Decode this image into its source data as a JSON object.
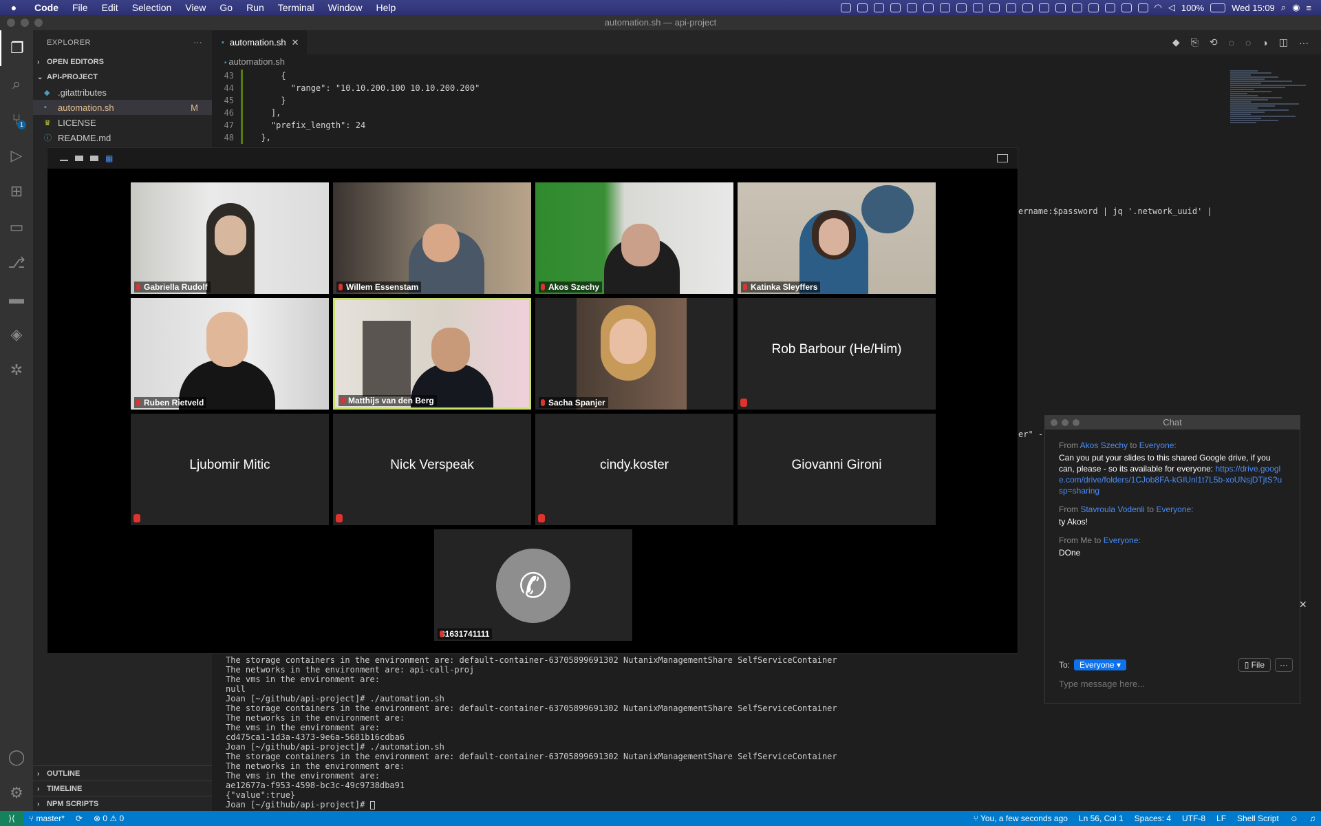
{
  "menubar": {
    "app": "Code",
    "menus": [
      "File",
      "Edit",
      "Selection",
      "View",
      "Go",
      "Run",
      "Terminal",
      "Window",
      "Help"
    ],
    "battery": "100%",
    "clock": "Wed 15:09"
  },
  "window": {
    "title": "automation.sh — api-project"
  },
  "activity_bar": {
    "scm_badge": "1"
  },
  "sidebar": {
    "title": "EXPLORER",
    "open_editors": "OPEN EDITORS",
    "project": "API-PROJECT",
    "files": [
      {
        "name": ".gitattributes",
        "status": ""
      },
      {
        "name": "automation.sh",
        "status": "M"
      },
      {
        "name": "LICENSE",
        "status": ""
      },
      {
        "name": "README.md",
        "status": ""
      }
    ],
    "outline": "OUTLINE",
    "timeline": "TIMELINE",
    "npm": "NPM SCRIPTS"
  },
  "editor": {
    "tab": "automation.sh",
    "breadcrumb": "automation.sh",
    "lines": [
      {
        "n": "43",
        "text": "      {"
      },
      {
        "n": "44",
        "text": "        \"range\": \"10.10.200.100 10.10.200.200\""
      },
      {
        "n": "45",
        "text": "      }"
      },
      {
        "n": "46",
        "text": "    ],"
      },
      {
        "n": "47",
        "text": "    \"prefix_length\": 24"
      },
      {
        "n": "48",
        "text": "  },"
      }
    ],
    "fragment1": "ername:$password | jq '.network_uuid' |",
    "fragment2": "er\" -"
  },
  "terminal": {
    "lines": [
      "The storage containers in the environment are: default-container-63705899691302 NutanixManagementShare SelfServiceContainer",
      "The networks in the environment are: api-call-proj",
      "The vms in the environment are:",
      "null",
      "Joan [~/github/api-project]# ./automation.sh",
      "The storage containers in the environment are: default-container-63705899691302 NutanixManagementShare SelfServiceContainer",
      "The networks in the environment are:",
      "The vms in the environment are:",
      "cd475ca1-1d3a-4373-9e6a-5681b16cdba6",
      "Joan [~/github/api-project]# ./automation.sh",
      "The storage containers in the environment are: default-container-63705899691302 NutanixManagementShare SelfServiceContainer",
      "The networks in the environment are:",
      "The vms in the environment are:",
      "ae12677a-f953-4598-bc3c-49c9738dba91",
      "{\"value\":true}"
    ],
    "prompt": "Joan [~/github/api-project]# "
  },
  "statusbar": {
    "branch": "master*",
    "problems": "⊗ 0 ⚠ 0",
    "blame": "You, a few seconds ago",
    "position": "Ln 56, Col 1",
    "spaces": "Spaces: 4",
    "encoding": "UTF-8",
    "eol": "LF",
    "language": "Shell Script"
  },
  "meeting": {
    "participants": [
      {
        "name": "Gabriella Rudolf",
        "video": true
      },
      {
        "name": "Willem Essenstam",
        "video": true
      },
      {
        "name": "Akos Szechy",
        "video": true
      },
      {
        "name": "Katinka Sleyffers",
        "video": true
      },
      {
        "name": "Ruben Rietveld",
        "video": true
      },
      {
        "name": "Matthijs van den Berg",
        "video": true,
        "speaking": true
      },
      {
        "name": "Sacha Spanjer",
        "video": true
      },
      {
        "name": "Rob Barbour (He/Him)",
        "video": false
      },
      {
        "name": "Ljubomir Mitic",
        "video": false
      },
      {
        "name": "Nick Verspeak",
        "video": false
      },
      {
        "name": "cindy.koster",
        "video": false
      },
      {
        "name": "Giovanni Gironi",
        "video": false
      }
    ],
    "phone_caller": "31631741111"
  },
  "chat": {
    "title": "Chat",
    "messages": [
      {
        "from_prefix": "From ",
        "from": "Akos Szechy",
        "to_prefix": " to ",
        "to": "Everyone:",
        "body": "Can you put your slides to this shared Google drive, if you can, please - so its available for everyone: ",
        "link": "https://drive.google.com/drive/folders/1CJob8FA-kGIUnl1t7L5b-xoUNsjDTjtS?usp=sharing"
      },
      {
        "from_prefix": "From ",
        "from": "Stavroula Vodenli",
        "to_prefix": " to ",
        "to": "Everyone:",
        "body": "ty Akos!",
        "link": ""
      },
      {
        "from_prefix": "From Me to ",
        "from": "",
        "to_prefix": "",
        "to": "Everyone:",
        "body": "DOne",
        "link": ""
      }
    ],
    "to_label": "To:",
    "recipient": "Everyone ▾",
    "file_btn": "File",
    "more_btn": "···",
    "placeholder": "Type message here..."
  }
}
